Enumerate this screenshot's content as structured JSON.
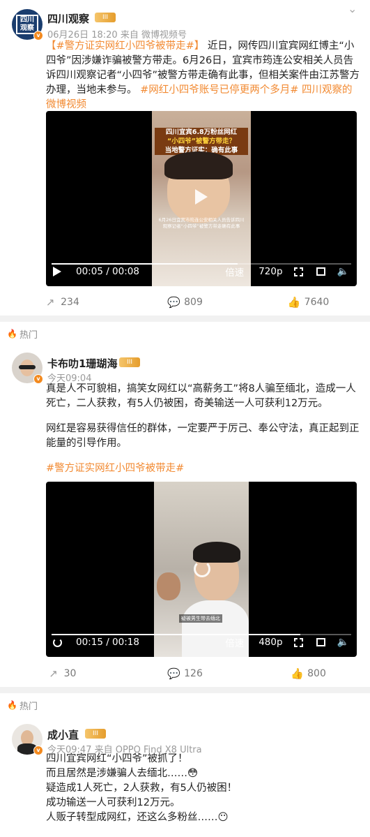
{
  "posts": [
    {
      "author": "四川观察",
      "level": "III",
      "meta": "06月26日 18:20  来自 微博视频号",
      "text_tag_start": "【#警方证实网红小四爷被带走#】",
      "text_body": "近日，网传四川宜宾网红博主“小四爷”因涉嫌诈骗被警方带走。6月26日，宜宾市筠连公安相关人员告诉四川观察记者“小四爷”被警方带走确有此事，但相关案件由江苏警方办理，当地未参与。",
      "text_tag_end": "#网红小四爷账号已停更两个多月#",
      "text_link": "四川观察的微博视频",
      "video": {
        "overlay_title_1": "四川宜宾6.8万粉丝网红",
        "overlay_title_2": "“小四爷”被警方带走？",
        "overlay_title_3": "当地警方证实：确有此事",
        "overlay_caption": "6月26日宜宾市筠连公安相关人员告诉四川观察记者“小四爷”被警方带走确有此事",
        "time": "00:05 / 00:08",
        "speed": "倍速",
        "quality": "720p",
        "progress": 0.62
      },
      "reposts": "234",
      "comments": "809",
      "likes": "7640"
    },
    {
      "hot_label": "热门",
      "author": "卡布叻1珊瑚海",
      "level": "III",
      "meta": "今天09:04",
      "text_p1": "真是人不可貌相，搞笑女网红以“高薪务工”将8人骗至缅北，造成一人死亡，二人获救，有5人仍被困，奇美输送一人可获利12万元。",
      "text_p2": "网红是容易获得信任的群体，一定要严于厉己、奉公守法，真正起到正能量的引导作用。",
      "text_tag": "#警方证实网红小四爷被带走#",
      "video": {
        "time": "00:15 / 00:18",
        "speed": "倍速",
        "quality": "480p",
        "caption": "疑被男生带去缅北",
        "progress": 0.83
      },
      "reposts": "30",
      "comments": "126",
      "likes": "800"
    },
    {
      "hot_label": "热门",
      "author": "成小直",
      "level": "III",
      "meta": "今天09:47  来自 OPPO Find X8 Ultra",
      "lines": [
        "四川宜宾网红“小四爷”被抓了！",
        "而且居然是涉嫌骗人去缅北……😳",
        "疑造成1人死亡，2人获救，有5人仍被困！",
        "成功输送一人可获利12万元。",
        "人贩子转型成网红，还这么多粉丝……😶"
      ]
    }
  ],
  "icons": {
    "repost": "repost-icon",
    "comment": "comment-icon",
    "like": "like-icon",
    "more": "chevron-down-icon",
    "play": "play-icon",
    "fullscreen": "fullscreen-icon",
    "pip": "pip-icon",
    "volume": "volume-icon",
    "replay": "replay-icon",
    "hot": "flame-icon"
  },
  "colors": {
    "accent": "#f28a32",
    "background": "#f1f1f1"
  }
}
